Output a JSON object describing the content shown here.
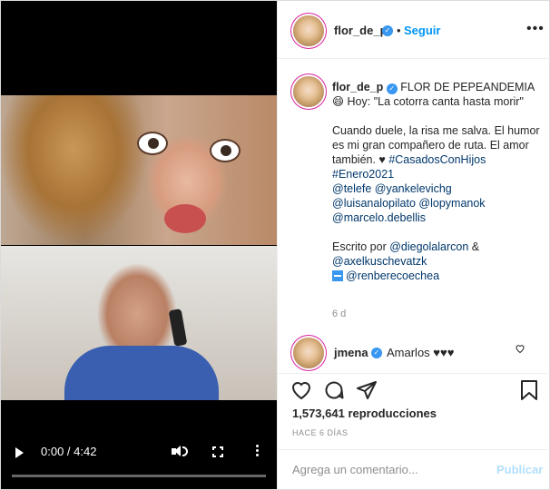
{
  "video": {
    "time": "0:00 / 4:42",
    "progress": 0.0
  },
  "header": {
    "username": "flor_de_p",
    "separator": "•",
    "follow_label": "Seguir",
    "more_icon": "more-horizontal-icon"
  },
  "caption": {
    "username": "flor_de_p",
    "line1": "FLOR DE PEPEANDEMIA",
    "emoji": "😄",
    "line2": "Hoy: \"La cotorra canta hasta morir\"",
    "paragraph": "Cuando duele, la risa me salva. El humor es mi gran compañero de ruta. El amor también. ♥",
    "hashtag1": "#CasadosConHijos",
    "hashtag2": "#Enero2021",
    "mention1": "@telefe",
    "mention2": "@yankelevichg",
    "mention3": "@luisanalopilato",
    "mention4": "@lopymanok",
    "mention5": "@marcelo.debellis",
    "written_by": "Escrito por",
    "mention6": "@diegolalarcon",
    "amp": "&",
    "mention7": "@axelkuschevatzk",
    "mention8": "@renberecoechea",
    "age": "6 d"
  },
  "comment": {
    "username": "jmena",
    "text": "Amarlos ♥♥♥"
  },
  "stats": {
    "views": "1,573,641 reproducciones",
    "date": "HACE 6 DÍAS"
  },
  "comment_box": {
    "placeholder": "Agrega un comentario...",
    "publish_label": "Publicar"
  },
  "colors": {
    "accent": "#0095f6",
    "verified": "#3897f0",
    "link": "#00376b"
  }
}
